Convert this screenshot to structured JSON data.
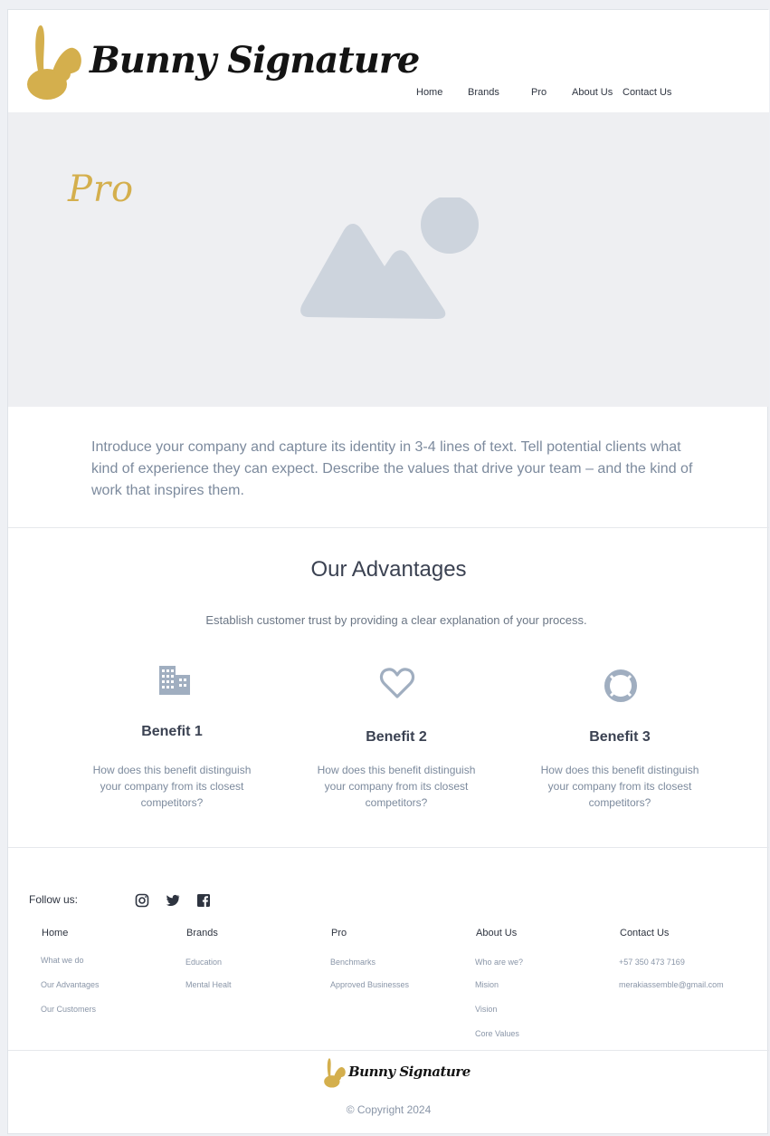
{
  "brand": {
    "name": "Bunny Signature"
  },
  "colors": {
    "accent": "#d4af4d",
    "icon": "#a0aec0",
    "placeholder": "#cdd4dd",
    "text_muted": "#7c8a9d"
  },
  "nav": {
    "items": [
      {
        "label": "Home"
      },
      {
        "label": "Brands"
      },
      {
        "label": "Pro"
      },
      {
        "label": "About Us"
      },
      {
        "label": "Contact Us"
      }
    ]
  },
  "hero": {
    "title": "Pro",
    "image_icon": "image-placeholder-icon"
  },
  "intro": {
    "text": "Introduce your company and capture its identity in 3-4 lines of text. Tell potential clients what kind of experience they can expect. Describe the values that drive your team – and the kind of work that inspires them."
  },
  "advantages": {
    "title": "Our Advantages",
    "subtitle": "Establish customer trust by providing a clear explanation of your process.",
    "benefits": [
      {
        "icon": "building-icon",
        "title": "Benefit 1",
        "text": "How does this benefit distinguish your company from its closest competitors?"
      },
      {
        "icon": "heart-icon",
        "title": "Benefit 2",
        "text": "How does this benefit distinguish your company from its closest competitors?"
      },
      {
        "icon": "lifebuoy-icon",
        "title": "Benefit 3",
        "text": "How does this benefit distinguish your company from its closest competitors?"
      }
    ]
  },
  "footer": {
    "follow_label": "Follow us:",
    "social": [
      "instagram-icon",
      "twitter-icon",
      "facebook-icon"
    ],
    "columns": [
      {
        "heading": "Home",
        "links": [
          "What we do",
          "Our Advantages",
          "Our Customers"
        ]
      },
      {
        "heading": "Brands",
        "links": [
          "Education",
          "Mental Healt"
        ]
      },
      {
        "heading": "Pro",
        "links": [
          "Benchmarks",
          "Approved Businesses"
        ]
      },
      {
        "heading": "About Us",
        "links": [
          "Who are we?",
          "Mision",
          "Vision",
          "Core Values"
        ]
      },
      {
        "heading": "Contact Us",
        "links": [
          "+57 350 473 7169",
          "merakiassemble@gmail.com"
        ]
      }
    ],
    "copyright": "© Copyright 2024"
  }
}
